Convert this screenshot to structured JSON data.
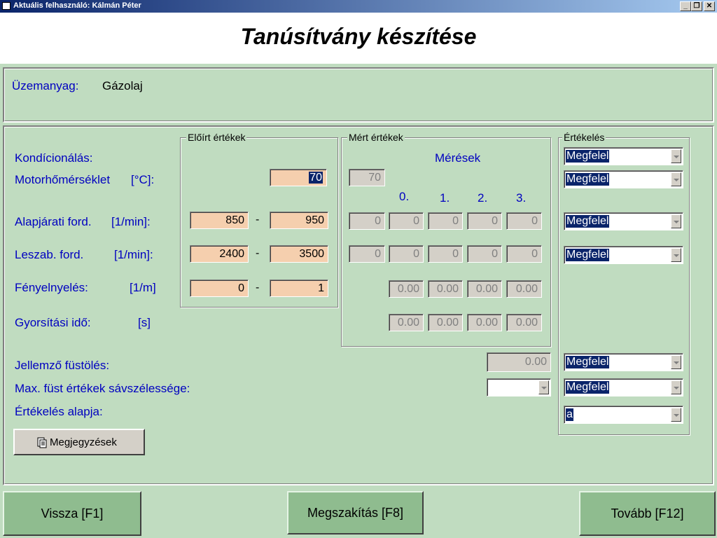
{
  "window": {
    "title": "Aktuális felhasználó: Kálmán Péter",
    "minimize": "_",
    "restore": "❐",
    "close": "✕"
  },
  "header": {
    "title": "Tanúsítvány készítése"
  },
  "fuel": {
    "label": "Üzemanyag:",
    "value": "Gázolaj"
  },
  "groups": {
    "prescribed": "Előírt értékek",
    "measured": "Mért értékek",
    "evaluation": "Értékelés"
  },
  "measurements": {
    "title": "Mérések",
    "columns": [
      "0.",
      "1.",
      "2.",
      "3."
    ]
  },
  "rows": {
    "conditioning": {
      "label": "Kondícionálás:",
      "evaluation": "Megfelel"
    },
    "engine_temp": {
      "label": "Motorhőmérséklet",
      "unit": "[°C]:",
      "prescribed": "70",
      "measured": "70",
      "evaluation": "Megfelel"
    },
    "idle_speed": {
      "label": "Alapjárati ford.",
      "unit": "[1/min]:",
      "min": "850",
      "dash": "-",
      "max": "950",
      "measured": [
        "0",
        "0",
        "0",
        "0",
        "0"
      ],
      "evaluation": "Megfelel"
    },
    "cutoff_speed": {
      "label": "Leszab. ford.",
      "unit": "[1/min]:",
      "min": "2400",
      "dash": "-",
      "max": "3500",
      "measured": [
        "0",
        "0",
        "0",
        "0",
        "0"
      ],
      "evaluation": "Megfelel"
    },
    "absorption": {
      "label": "Fényelnyelés:",
      "unit": "[1/m]",
      "min": "0",
      "dash": "-",
      "max": "1",
      "measured": [
        "0.00",
        "0.00",
        "0.00",
        "0.00"
      ]
    },
    "accel_time": {
      "label": "Gyorsítási idő:",
      "unit": "[s]",
      "measured": [
        "0.00",
        "0.00",
        "0.00",
        "0.00"
      ]
    },
    "smoke": {
      "label": "Jellemző füstölés:",
      "value": "0.00",
      "evaluation": "Megfelel"
    },
    "bandwidth": {
      "label": "Max. füst értékek sávszélessége:",
      "value": "",
      "evaluation": "Megfelel"
    },
    "basis": {
      "label": "Értékelés alapja:",
      "value": "a"
    }
  },
  "notes_button": "Megjegyzések",
  "footer": {
    "back": "Vissza [F1]",
    "abort": "Megszakítás [F8]",
    "next": "Tovább [F12]"
  },
  "colors": {
    "background": "#c0dcc0",
    "label_blue": "#0000c0",
    "required_field": "#f5cfae",
    "footer_button": "#8fbc8f"
  }
}
